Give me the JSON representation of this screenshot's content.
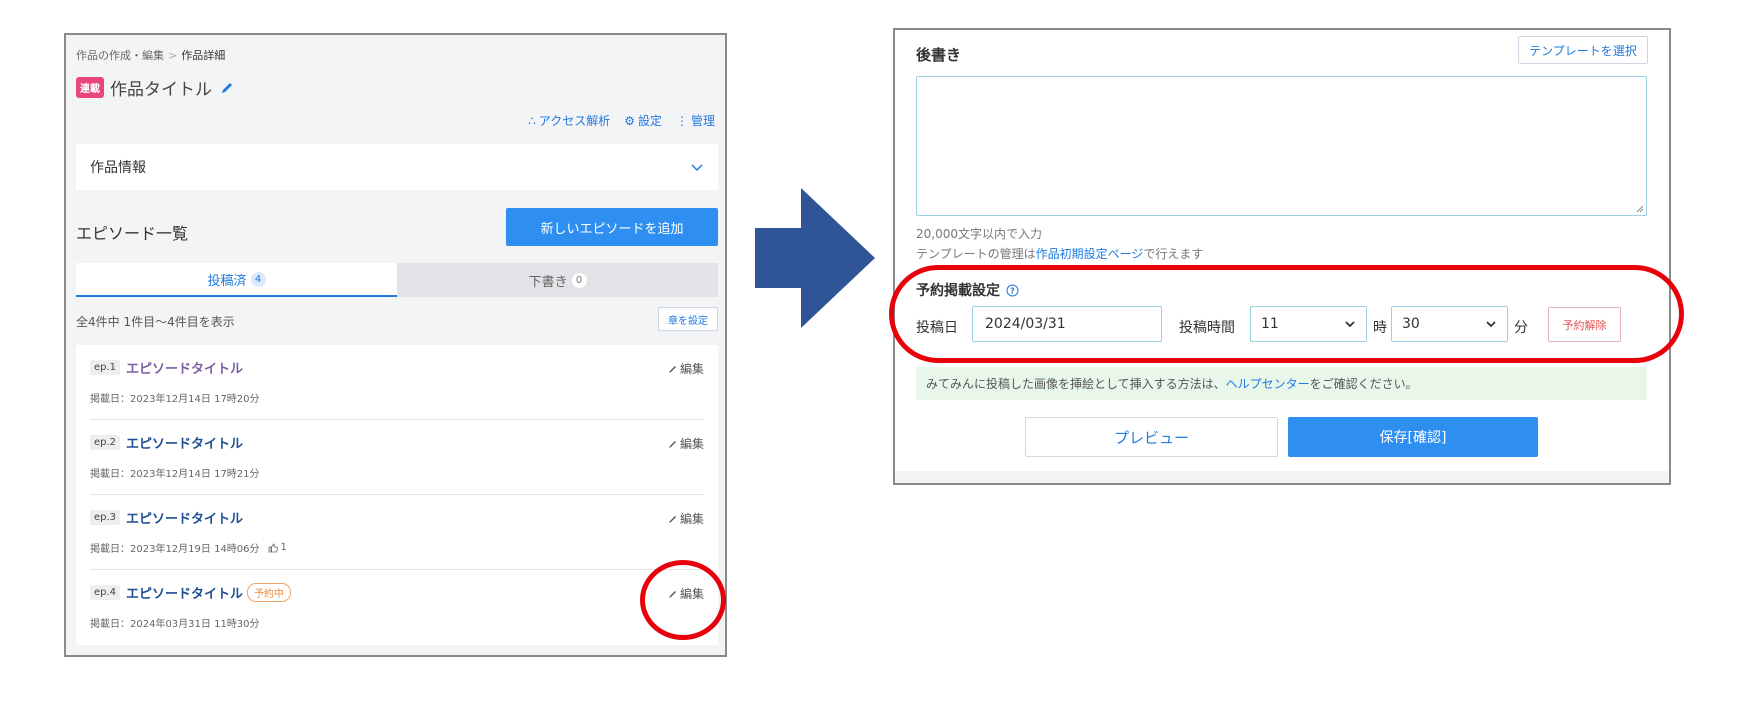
{
  "left": {
    "breadcrumb": {
      "parent": "作品の作成・編集",
      "current": "作品詳細"
    },
    "badge": "連載",
    "work_title": "作品タイトル",
    "tools": {
      "analytics": "アクセス解析",
      "settings": "設定",
      "manage": "管理"
    },
    "info_section": "作品情報",
    "episode_heading": "エピソード一覧",
    "add_episode_button": "新しいエピソードを追加",
    "tabs": [
      {
        "label": "投稿済",
        "count": "4"
      },
      {
        "label": "下書き",
        "count": "0"
      }
    ],
    "summary": "全4件中 1件目〜4件目を表示",
    "chapter_button": "章を設定",
    "edit_label": "編集",
    "episodes": [
      {
        "num": "ep.1",
        "title": "エピソードタイトル",
        "date": "掲載日：2023年12月14日 17時20分"
      },
      {
        "num": "ep.2",
        "title": "エピソードタイトル",
        "date": "掲載日：2023年12月14日 17時21分"
      },
      {
        "num": "ep.3",
        "title": "エピソードタイトル",
        "date": "掲載日：2023年12月19日 14時06分",
        "likes": "1"
      },
      {
        "num": "ep.4",
        "title": "エピソードタイトル",
        "tag": "予約中",
        "date": "掲載日：2024年03月31日 11時30分"
      }
    ]
  },
  "right": {
    "afterword_label": "後書き",
    "template_button": "テンプレートを選択",
    "char_limit_hint": "20,000文字以内で入力",
    "template_hint": {
      "before": "テンプレートの管理は",
      "link": "作品初期設定ページ",
      "after": "で行えます"
    },
    "schedule_label": "予約掲載設定",
    "post_date_label": "投稿日",
    "post_date_value": "2024/03/31",
    "post_time_label": "投稿時間",
    "hour_value": "11",
    "hour_unit": "時",
    "minute_value": "30",
    "minute_unit": "分",
    "unschedule_button": "予約解除",
    "info": {
      "before": "みてみんに投稿した画像を挿絵として挿入する方法は、",
      "link": "ヘルプセンター",
      "after": "をご確認ください。"
    },
    "preview_button": "プレビュー",
    "save_button": "保存[確認]"
  },
  "colors": {
    "accent": "#2f8ff0",
    "highlight": "#e8000b",
    "arrow": "#2f5597",
    "badge": "#e8467c"
  }
}
